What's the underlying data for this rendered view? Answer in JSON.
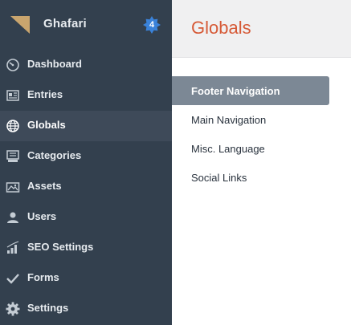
{
  "site": {
    "name": "Ghafari",
    "badge_count": "4",
    "logo_icon": "triangle-logo"
  },
  "colors": {
    "sidebar_bg": "#33404e",
    "sidebar_selected_bg": "#3e4a59",
    "page_title": "#d65a37",
    "selected_set_bg": "#7c8895",
    "badge_bg": "#3a82d9"
  },
  "sidebar": {
    "items": [
      {
        "label": "Dashboard",
        "icon": "dashboard-icon"
      },
      {
        "label": "Entries",
        "icon": "entries-icon"
      },
      {
        "label": "Globals",
        "icon": "globe-icon",
        "selected": true
      },
      {
        "label": "Categories",
        "icon": "categories-icon"
      },
      {
        "label": "Assets",
        "icon": "assets-icon"
      },
      {
        "label": "Users",
        "icon": "users-icon"
      },
      {
        "label": "SEO Settings",
        "icon": "seo-icon"
      },
      {
        "label": "Forms",
        "icon": "checkmark-icon"
      },
      {
        "label": "Settings",
        "icon": "gear-icon"
      }
    ]
  },
  "main": {
    "title": "Globals",
    "global_sets": [
      {
        "label": "Footer Navigation",
        "selected": true
      },
      {
        "label": "Main Navigation"
      },
      {
        "label": "Misc. Language"
      },
      {
        "label": "Social Links"
      }
    ]
  }
}
